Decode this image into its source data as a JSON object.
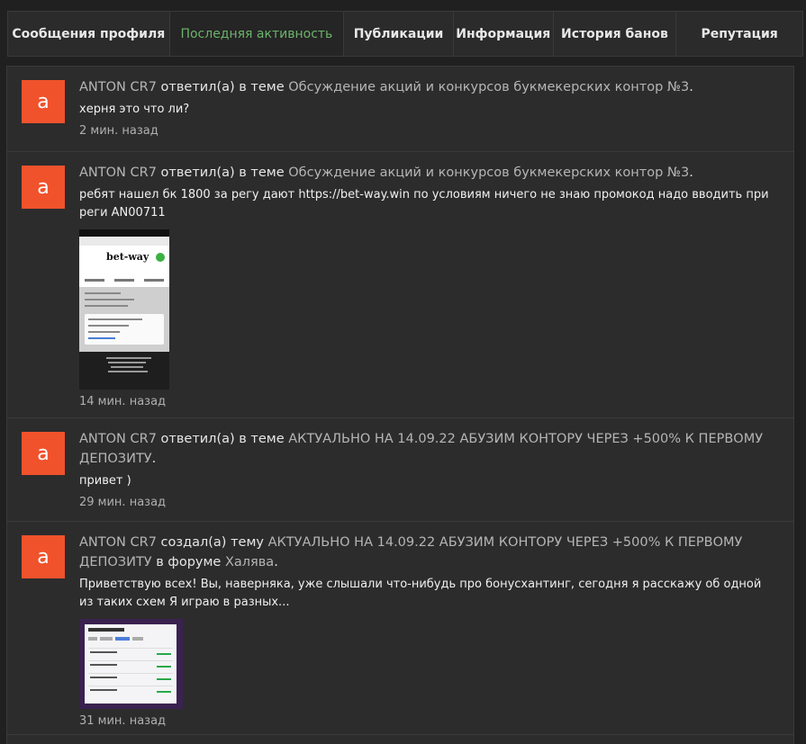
{
  "tabs": [
    {
      "label": "Сообщения профиля"
    },
    {
      "label": "Последняя активность"
    },
    {
      "label": "Публикации"
    },
    {
      "label": "Информация"
    },
    {
      "label": "История банов"
    },
    {
      "label": "Репутация"
    }
  ],
  "active_tab": "Последняя активность",
  "colors": {
    "avatar_bg": "#f0522c",
    "active_tab": "#6bb36b",
    "link": "#b5b5b5",
    "background": "#2c2c2c"
  },
  "feed": [
    {
      "avatar_letter": "a",
      "user": "ANTON CR7",
      "action": " ответил(а) в теме ",
      "thread": "Обсуждение акций и конкурсов букмекерских контор №3",
      "suffix": ".",
      "snippet": "херня это что ли?",
      "time": "2 мин. назад"
    },
    {
      "avatar_letter": "a",
      "user": "ANTON CR7",
      "action": " ответил(а) в теме ",
      "thread": "Обсуждение акций и конкурсов букмекерских контор №3",
      "suffix": ".",
      "snippet": "ребят нашел бк 1800 за регу дают https://bet-way.win по условиям ничего не знаю промокод надо вводить при реги AN00711",
      "thumb_logo": "bet-way",
      "time": "14 мин. назад"
    },
    {
      "avatar_letter": "a",
      "user": "ANTON CR7",
      "action": " ответил(а) в теме ",
      "thread": "АКТУАЛЬНО НА 14.09.22 АБУЗИМ КОНТОРУ ЧЕРЕЗ +500% К ПЕРВОМУ ДЕПОЗИТУ",
      "suffix": ".",
      "snippet": "привет )",
      "time": "29 мин. назад"
    },
    {
      "avatar_letter": "a",
      "user": "ANTON CR7",
      "action": " создал(а) тему ",
      "thread": "АКТУАЛЬНО НА 14.09.22 АБУЗИМ КОНТОРУ ЧЕРЕЗ +500% К ПЕРВОМУ ДЕПОЗИТУ",
      "forum_prefix": " в форуме ",
      "forum": "Халява",
      "suffix": ".",
      "snippet": "Приветствую всех! Вы, наверняка, уже слышали что-нибудь про бонусхантинг, сегодня я расскажу об одной из таких схем Я играю в разных...",
      "time": "31 мин. назад"
    }
  ]
}
